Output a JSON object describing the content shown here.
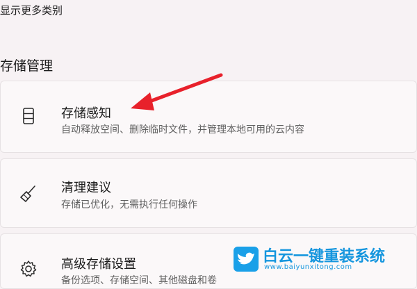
{
  "top_link": {
    "label": "显示更多类别"
  },
  "section": {
    "title": "存储管理"
  },
  "cards": [
    {
      "icon": "storage-drive-icon",
      "title": "存储感知",
      "description": "自动释放空间、删除临时文件，并管理本地可用的云内容"
    },
    {
      "icon": "broom-icon",
      "title": "清理建议",
      "description": "存储已优化，无需执行任何操作"
    },
    {
      "icon": "gear-icon",
      "title": "高级存储设置",
      "description": "备份选项、存储空间、其他磁盘和卷"
    }
  ],
  "annotation": {
    "icon": "red-arrow-icon",
    "color": "#e8212b"
  },
  "watermark": {
    "icon": "bird-logo-icon",
    "title": "白云一键重装系统",
    "url": "www.baiyunxitong.com",
    "color": "#1696de"
  }
}
